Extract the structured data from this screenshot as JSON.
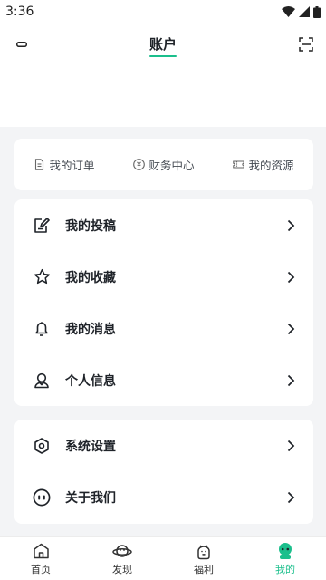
{
  "status_bar": {
    "time": "3:36"
  },
  "header": {
    "title": "账户"
  },
  "quick_links": [
    {
      "label": "我的订单",
      "icon": "document-icon"
    },
    {
      "label": "财务中心",
      "icon": "currency-icon"
    },
    {
      "label": "我的资源",
      "icon": "ticket-icon"
    }
  ],
  "menu_group_1": [
    {
      "label": "我的投稿",
      "icon": "edit-icon"
    },
    {
      "label": "我的收藏",
      "icon": "star-icon"
    },
    {
      "label": "我的消息",
      "icon": "bell-icon"
    },
    {
      "label": "个人信息",
      "icon": "user-icon"
    }
  ],
  "menu_group_2": [
    {
      "label": "系统设置",
      "icon": "settings-icon"
    },
    {
      "label": "关于我们",
      "icon": "smile-icon"
    }
  ],
  "tabs": [
    {
      "label": "首页",
      "icon": "home-icon"
    },
    {
      "label": "发现",
      "icon": "planet-icon"
    },
    {
      "label": "福利",
      "icon": "gift-icon"
    },
    {
      "label": "我的",
      "icon": "profile-icon",
      "active": true
    }
  ],
  "colors": {
    "accent": "#1bbf8c",
    "text": "#1f2329",
    "background": "#f3f4f6"
  }
}
